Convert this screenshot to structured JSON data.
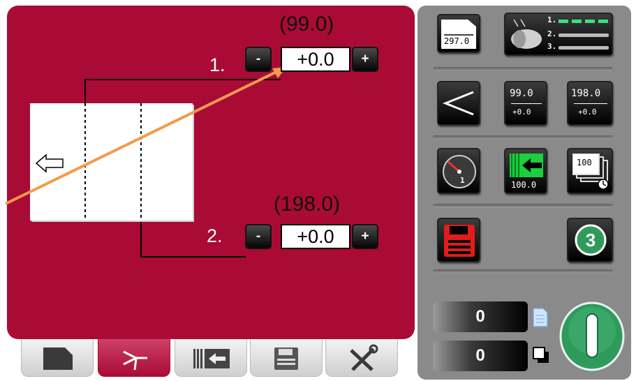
{
  "positions": [
    {
      "index_label": "1.",
      "nominal": "(99.0)",
      "offset": "+0.0",
      "minus_label": "-",
      "plus_label": "+"
    },
    {
      "index_label": "2.",
      "nominal": "(198.0)",
      "offset": "+0.0",
      "minus_label": "-",
      "plus_label": "+"
    }
  ],
  "toolbar": {
    "format_length": "297.0",
    "roller_list": [
      "1.",
      "2.",
      "3."
    ],
    "fold1_value": "99.0",
    "fold1_offset": "+0.0",
    "fold2_value": "198.0",
    "fold2_offset": "+0.0",
    "speed_value": "1",
    "feed_value": "100.0",
    "batch_value": "100",
    "program_number": "3"
  },
  "counters": {
    "sheets": "0",
    "stacks": "0"
  },
  "tabs": [
    "document-tab",
    "fold-tab",
    "feed-tab",
    "save-tab",
    "tools-tab"
  ],
  "colors": {
    "panel_red": "#a90b35",
    "panel_gray": "#8a8a8a",
    "arrow_orange": "#f39b4c",
    "start_green": "#2f9a5c"
  }
}
